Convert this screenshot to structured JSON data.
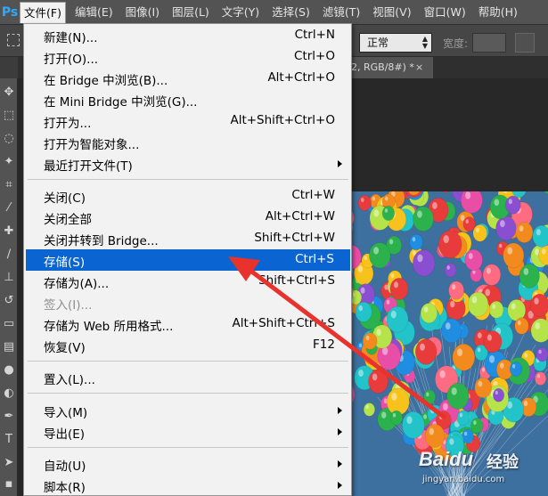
{
  "app": {
    "logo": "Ps"
  },
  "menubar": {
    "items": [
      {
        "label": "文件(F)"
      },
      {
        "label": "编辑(E)"
      },
      {
        "label": "图像(I)"
      },
      {
        "label": "图层(L)"
      },
      {
        "label": "文字(Y)"
      },
      {
        "label": "选择(S)"
      },
      {
        "label": "滤镜(T)"
      },
      {
        "label": "视图(V)"
      },
      {
        "label": "窗口(W)"
      },
      {
        "label": "帮助(H)"
      }
    ],
    "active_index": 0
  },
  "options_bar": {
    "blend_mode": "正常",
    "width_label": "宽度:"
  },
  "document": {
    "tab_title": "2, RGB/8#) *",
    "close_symbol": "×"
  },
  "file_menu": {
    "items": [
      {
        "label": "新建(N)...",
        "shortcut": "Ctrl+N"
      },
      {
        "label": "打开(O)...",
        "shortcut": "Ctrl+O"
      },
      {
        "label": "在 Bridge 中浏览(B)...",
        "shortcut": "Alt+Ctrl+O"
      },
      {
        "label": "在 Mini Bridge 中浏览(G)...",
        "shortcut": ""
      },
      {
        "label": "打开为...",
        "shortcut": "Alt+Shift+Ctrl+O"
      },
      {
        "label": "打开为智能对象...",
        "shortcut": ""
      },
      {
        "label": "最近打开文件(T)",
        "shortcut": ""
      },
      {
        "label": "关闭(C)",
        "shortcut": "Ctrl+W"
      },
      {
        "label": "关闭全部",
        "shortcut": "Alt+Ctrl+W"
      },
      {
        "label": "关闭并转到 Bridge...",
        "shortcut": "Shift+Ctrl+W"
      },
      {
        "label": "存储(S)",
        "shortcut": "Ctrl+S"
      },
      {
        "label": "存储为(A)...",
        "shortcut": "Shift+Ctrl+S"
      },
      {
        "label": "签入(I)...",
        "shortcut": ""
      },
      {
        "label": "存储为 Web 所用格式...",
        "shortcut": "Alt+Shift+Ctrl+S"
      },
      {
        "label": "恢复(V)",
        "shortcut": "F12"
      },
      {
        "label": "置入(L)...",
        "shortcut": ""
      },
      {
        "label": "导入(M)",
        "shortcut": ""
      },
      {
        "label": "导出(E)",
        "shortcut": ""
      },
      {
        "label": "自动(U)",
        "shortcut": ""
      },
      {
        "label": "脚本(R)",
        "shortcut": ""
      }
    ],
    "highlighted_index": 10,
    "disabled_indices": [
      12
    ],
    "submenu_indices": [
      6,
      16,
      17,
      18,
      19
    ]
  },
  "watermark": {
    "brand": "Baidu",
    "suffix": "经验",
    "url": "jingyan.baidu.com"
  },
  "colors": {
    "menu_highlight": "#0a64d2",
    "annotation_arrow": "#e8322b",
    "menubar_bg": "#535353",
    "menu_bg": "#f2f2f2"
  }
}
